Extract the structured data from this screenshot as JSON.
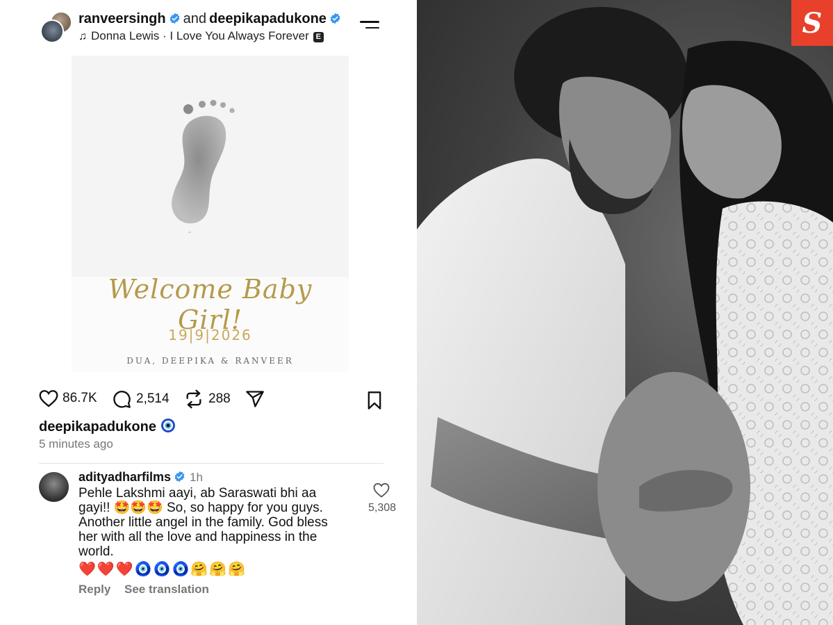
{
  "post": {
    "user1": "ranveersingh",
    "and_text": "and",
    "user2": "deepikapadukone",
    "song": "Donna Lewis · I Love You Always Forever",
    "explicit_badge": "E",
    "image": {
      "headline": "Welcome Baby Girl!",
      "date": "19|9|2026",
      "names": "DUA, DEEPIKA & RANVEER"
    },
    "stats": {
      "likes": "86.7K",
      "comments": "2,514",
      "reposts": "288"
    },
    "caption_user": "deepikapadukone",
    "time_ago": "5 minutes ago"
  },
  "comment": {
    "user": "adityadharfilms",
    "age": "1h",
    "text": "Pehle Lakshmi aayi, ab Saraswati bhi aa gayi!! 🤩🤩🤩 So, so happy for you guys. Another little angel in the family. God bless her with all the love and happiness in the world.",
    "emojis": "❤️❤️❤️🧿🧿🧿🤗🤗🤗",
    "likes": "5,308",
    "reply_label": "Reply",
    "translate_label": "See translation"
  },
  "icons": {
    "like": "heart-icon",
    "comment": "comment-icon",
    "repost": "repost-icon",
    "share": "send-icon",
    "save": "bookmark-icon",
    "menu": "hamburger-menu-icon",
    "music": "music-note-icon"
  },
  "colors": {
    "verified": "#3897f0",
    "logo": "#e8402b",
    "gold": "#b59a4a"
  }
}
